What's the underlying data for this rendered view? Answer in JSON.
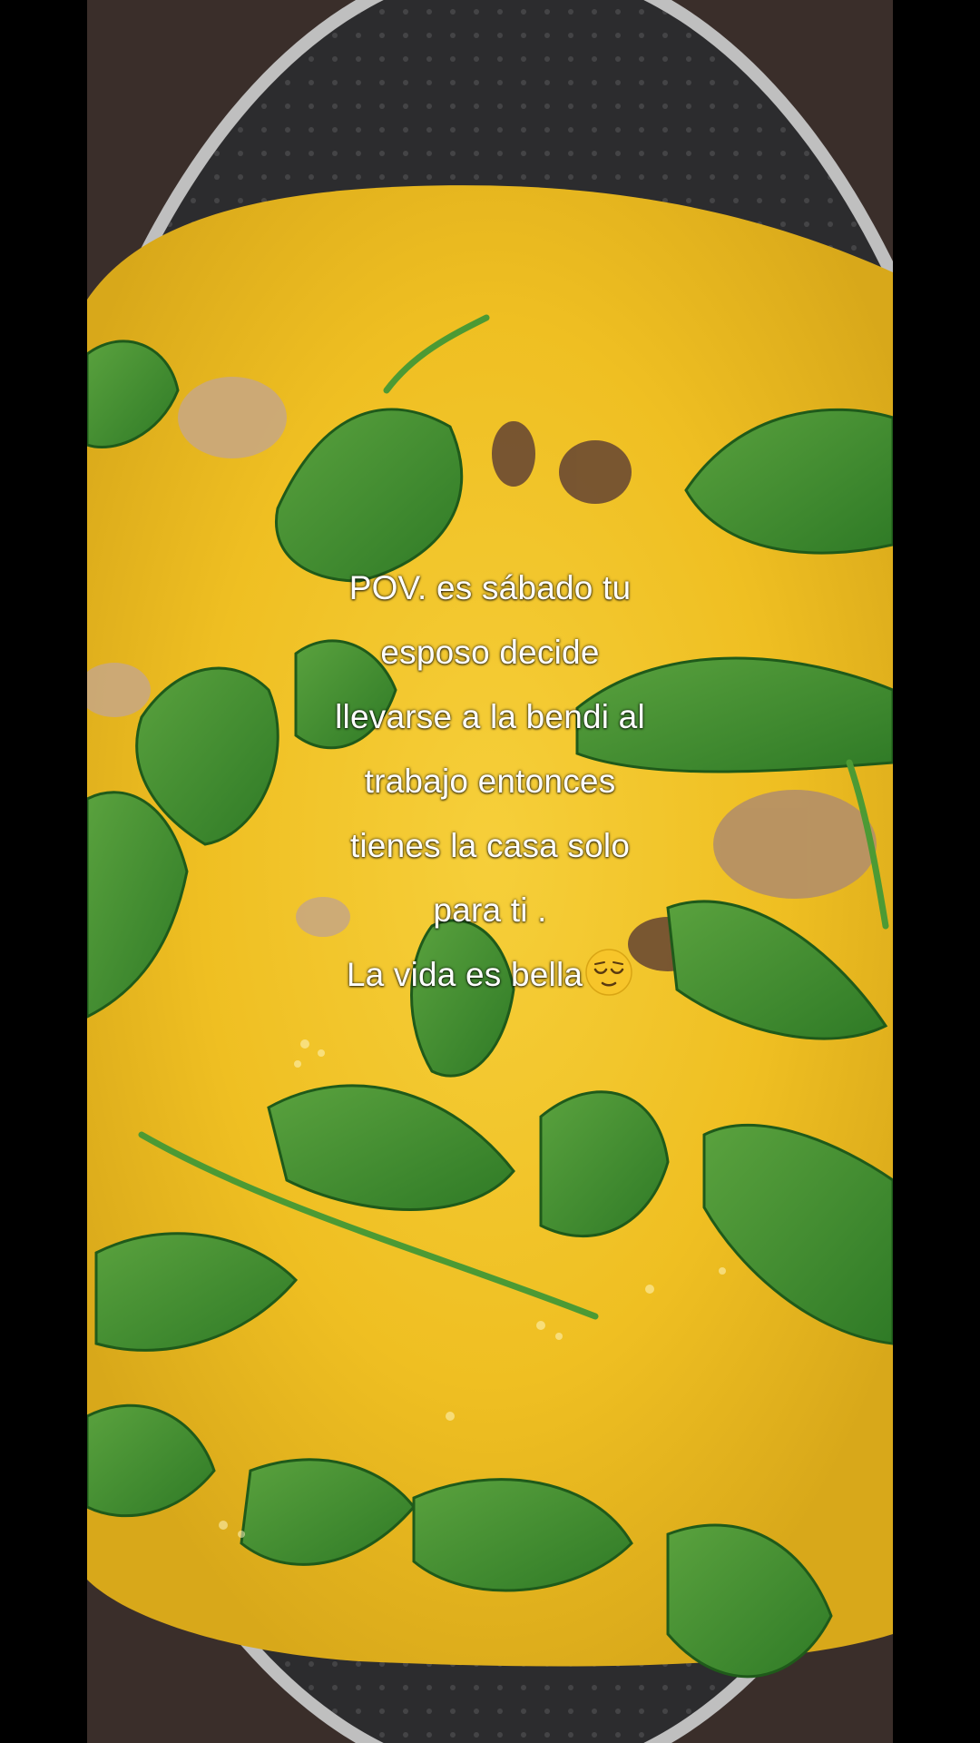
{
  "caption": {
    "lines": [
      "POV. es sábado tu",
      "esposo decide",
      "llevarse a la bendi al",
      "trabajo entonces",
      "tienes la casa solo",
      "para ti .",
      "La vida es bella"
    ],
    "emoji": "relieved-face-emoji"
  },
  "photo": {
    "subject": "omelette-with-spinach-in-pan-icon",
    "colors": {
      "egg": "#f2c42a",
      "spinach": "#3e8a2e",
      "pan": "#2c2c2e",
      "background": "#000000"
    }
  }
}
